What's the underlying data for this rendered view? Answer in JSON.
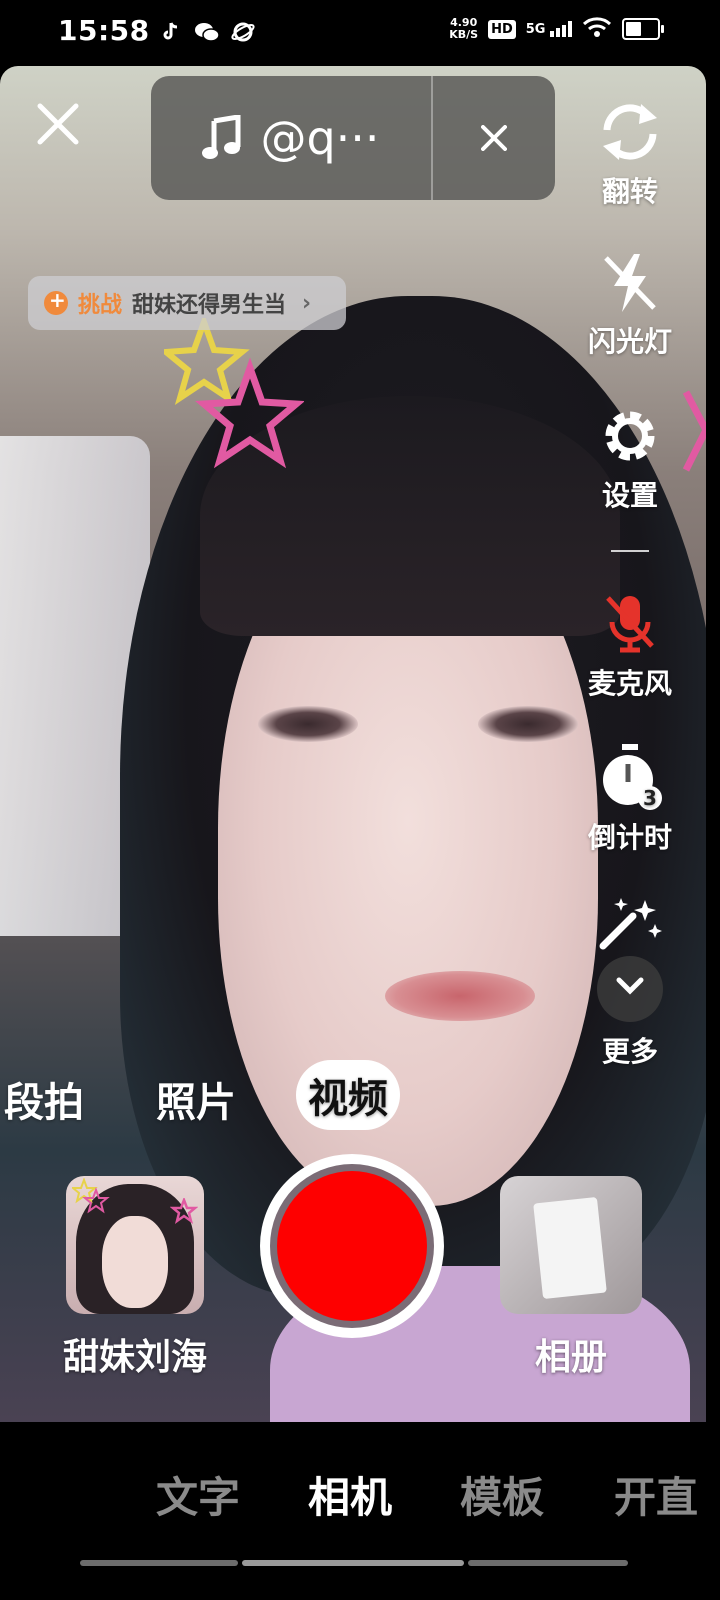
{
  "status_bar": {
    "time": "15:58",
    "speed_value": "4.90",
    "speed_unit": "KB/S",
    "hd": "HD",
    "network": "5G",
    "battery_level": 0.45
  },
  "top_bar": {
    "music_label": "@q···"
  },
  "challenge": {
    "tag": "挑战",
    "label": "甜妹还得男生当",
    "chevron": "›"
  },
  "right_rail": {
    "flip": "翻转",
    "flash": "闪光灯",
    "settings": "设置",
    "mic": "麦克风",
    "timer": "倒计时",
    "timer_badge": "3",
    "more": "更多"
  },
  "modes": [
    "段拍",
    "照片",
    "视频"
  ],
  "active_mode": "视频",
  "effect": {
    "label": "甜妹刘海"
  },
  "album": {
    "label": "相册"
  },
  "bottom_nav": [
    "文字",
    "相机",
    "模板",
    "开直"
  ],
  "active_nav": "相机",
  "colors": {
    "record_red": "#fe0000",
    "challenge_orange": "#f08a3c",
    "mic_off_red": "#e5332b"
  }
}
